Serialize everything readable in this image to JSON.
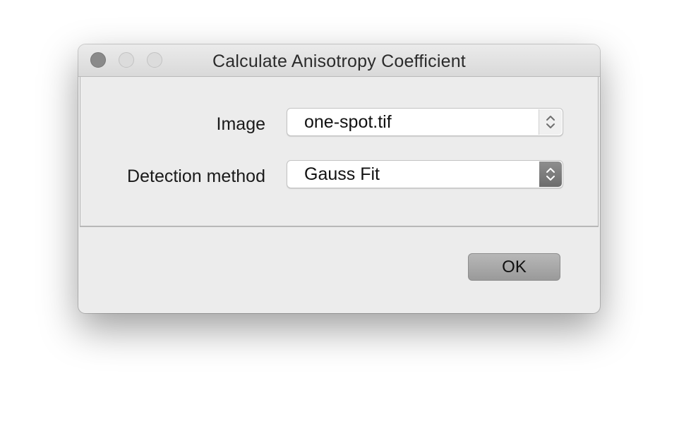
{
  "window": {
    "title": "Calculate Anisotropy Coefficient"
  },
  "form": {
    "image_label": "Image",
    "image_value": "one-spot.tif",
    "method_label": "Detection method",
    "method_value": "Gauss Fit"
  },
  "buttons": {
    "ok_label": "OK"
  },
  "icons": {
    "close": "close-icon",
    "minimize": "minimize-icon",
    "zoom": "zoom-icon",
    "stepper": "chevron-up-down-icon"
  }
}
